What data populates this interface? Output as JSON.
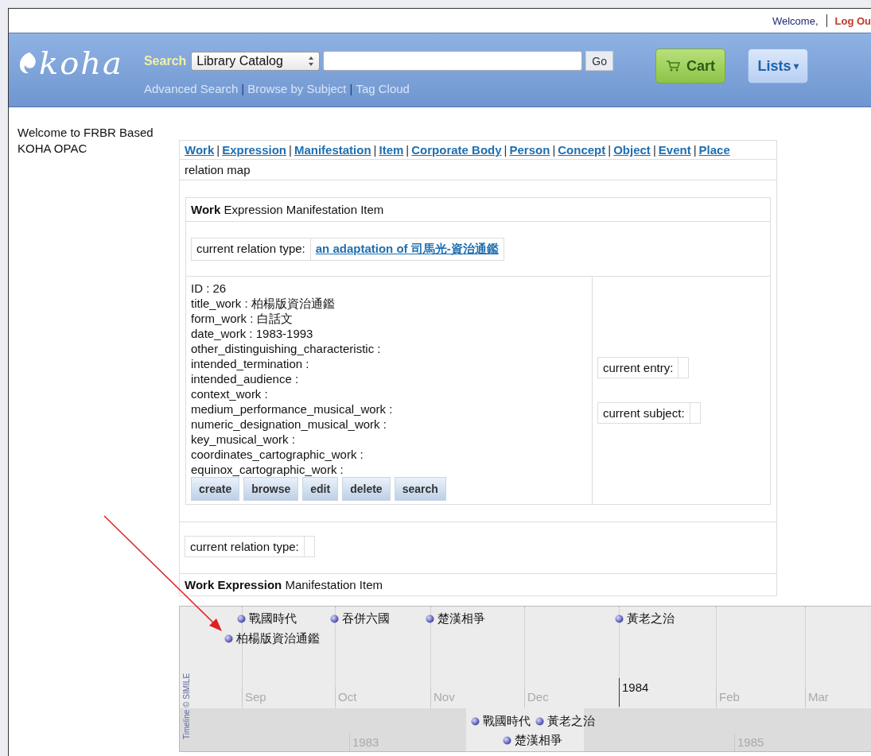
{
  "top_bar": {
    "welcome": "Welcome,",
    "logout": "Log Ou"
  },
  "header": {
    "logo": "koha",
    "search_label": "Search",
    "catalog_select": "Library Catalog",
    "go_button": "Go",
    "cart_button": "Cart",
    "lists_button": "Lists",
    "lists_caret": "▾",
    "links": [
      {
        "kind": "link",
        "text": "Advanced Search"
      },
      {
        "kind": "separator",
        "text": "|"
      },
      {
        "kind": "link",
        "text": "Browse by Subject"
      },
      {
        "kind": "separator",
        "text": "|"
      },
      {
        "kind": "link",
        "text": "Tag Cloud"
      }
    ]
  },
  "sidebar": {
    "welcome": "Welcome to FRBR Based KOHA OPAC"
  },
  "nav": [
    {
      "kind": "link",
      "text": "Work "
    },
    {
      "kind": "separator",
      "text": "|"
    },
    {
      "kind": "link",
      "text": "Expression "
    },
    {
      "kind": "separator",
      "text": "|"
    },
    {
      "kind": "link",
      "text": "Manifestation "
    },
    {
      "kind": "separator",
      "text": "|"
    },
    {
      "kind": "link",
      "text": "Item "
    },
    {
      "kind": "separator",
      "text": "|"
    },
    {
      "kind": "link",
      "text": "Corporate Body "
    },
    {
      "kind": "separator",
      "text": "|"
    },
    {
      "kind": "link",
      "text": "Person "
    },
    {
      "kind": "separator",
      "text": "|"
    },
    {
      "kind": "link",
      "text": "Concept "
    },
    {
      "kind": "separator",
      "text": "|"
    },
    {
      "kind": "link",
      "text": "Object "
    },
    {
      "kind": "separator",
      "text": "|"
    },
    {
      "kind": "link",
      "text": "Event "
    },
    {
      "kind": "separator",
      "text": "|"
    },
    {
      "kind": "link",
      "text": "Place"
    }
  ],
  "relation_map": "relation map",
  "panel": {
    "heading": "**Work** Expression Manifestation Item",
    "relation_label": "current relation type:",
    "relation_link": "an adaptation of 司馬光-資治通鑑",
    "fields": [
      "ID : 26",
      "title_work : 柏楊版資治通鑑",
      "form_work : 白話文",
      "date_work : 1983-1993",
      "other_distinguishing_characteristic :",
      "intended_termination :",
      "intended_audience :",
      "context_work :",
      "medium_performance_musical_work :",
      "numeric_designation_musical_work :",
      "key_musical_work :",
      "coordinates_cartographic_work :",
      "equinox_cartographic_work :"
    ],
    "buttons": [
      "create",
      "browse",
      "edit",
      "delete",
      "search"
    ],
    "entry_label": "current entry:",
    "subject_label": "current subject:"
  },
  "relation_row_label": "current relation type:",
  "footer_heading": "**Work Expression** Manifestation Item",
  "timeline": {
    "credit": "Timeline © SIMILE",
    "events": [
      "戰國時代",
      "吞併六國",
      "楚漢相爭",
      "黃老之治",
      "柏楊版資治通鑑"
    ],
    "ticks": [
      {
        "label": "Sep",
        "kind": "month"
      },
      {
        "label": "Oct",
        "kind": "month"
      },
      {
        "label": "Nov",
        "kind": "month"
      },
      {
        "label": "Dec",
        "kind": "month"
      },
      {
        "label": "1984",
        "kind": "year"
      },
      {
        "label": "Feb",
        "kind": "month"
      },
      {
        "label": "Mar",
        "kind": "month"
      }
    ],
    "overview_events": [
      "戰國時代",
      "黃老之治",
      "楚漢相爭"
    ],
    "overview_ticks": [
      "1983",
      "1985"
    ]
  }
}
